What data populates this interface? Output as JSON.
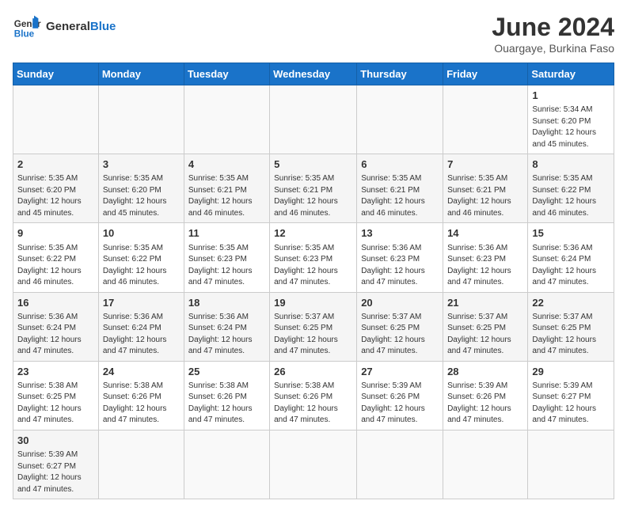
{
  "header": {
    "logo_line1": "General",
    "logo_line2": "Blue",
    "month_title": "June 2024",
    "subtitle": "Ouargaye, Burkina Faso"
  },
  "days_of_week": [
    "Sunday",
    "Monday",
    "Tuesday",
    "Wednesday",
    "Thursday",
    "Friday",
    "Saturday"
  ],
  "weeks": [
    [
      {
        "day": "",
        "info": ""
      },
      {
        "day": "",
        "info": ""
      },
      {
        "day": "",
        "info": ""
      },
      {
        "day": "",
        "info": ""
      },
      {
        "day": "",
        "info": ""
      },
      {
        "day": "",
        "info": ""
      },
      {
        "day": "1",
        "info": "Sunrise: 5:34 AM\nSunset: 6:20 PM\nDaylight: 12 hours and 45 minutes."
      }
    ],
    [
      {
        "day": "2",
        "info": "Sunrise: 5:35 AM\nSunset: 6:20 PM\nDaylight: 12 hours and 45 minutes."
      },
      {
        "day": "3",
        "info": "Sunrise: 5:35 AM\nSunset: 6:20 PM\nDaylight: 12 hours and 45 minutes."
      },
      {
        "day": "4",
        "info": "Sunrise: 5:35 AM\nSunset: 6:21 PM\nDaylight: 12 hours and 46 minutes."
      },
      {
        "day": "5",
        "info": "Sunrise: 5:35 AM\nSunset: 6:21 PM\nDaylight: 12 hours and 46 minutes."
      },
      {
        "day": "6",
        "info": "Sunrise: 5:35 AM\nSunset: 6:21 PM\nDaylight: 12 hours and 46 minutes."
      },
      {
        "day": "7",
        "info": "Sunrise: 5:35 AM\nSunset: 6:21 PM\nDaylight: 12 hours and 46 minutes."
      },
      {
        "day": "8",
        "info": "Sunrise: 5:35 AM\nSunset: 6:22 PM\nDaylight: 12 hours and 46 minutes."
      }
    ],
    [
      {
        "day": "9",
        "info": "Sunrise: 5:35 AM\nSunset: 6:22 PM\nDaylight: 12 hours and 46 minutes."
      },
      {
        "day": "10",
        "info": "Sunrise: 5:35 AM\nSunset: 6:22 PM\nDaylight: 12 hours and 46 minutes."
      },
      {
        "day": "11",
        "info": "Sunrise: 5:35 AM\nSunset: 6:23 PM\nDaylight: 12 hours and 47 minutes."
      },
      {
        "day": "12",
        "info": "Sunrise: 5:35 AM\nSunset: 6:23 PM\nDaylight: 12 hours and 47 minutes."
      },
      {
        "day": "13",
        "info": "Sunrise: 5:36 AM\nSunset: 6:23 PM\nDaylight: 12 hours and 47 minutes."
      },
      {
        "day": "14",
        "info": "Sunrise: 5:36 AM\nSunset: 6:23 PM\nDaylight: 12 hours and 47 minutes."
      },
      {
        "day": "15",
        "info": "Sunrise: 5:36 AM\nSunset: 6:24 PM\nDaylight: 12 hours and 47 minutes."
      }
    ],
    [
      {
        "day": "16",
        "info": "Sunrise: 5:36 AM\nSunset: 6:24 PM\nDaylight: 12 hours and 47 minutes."
      },
      {
        "day": "17",
        "info": "Sunrise: 5:36 AM\nSunset: 6:24 PM\nDaylight: 12 hours and 47 minutes."
      },
      {
        "day": "18",
        "info": "Sunrise: 5:36 AM\nSunset: 6:24 PM\nDaylight: 12 hours and 47 minutes."
      },
      {
        "day": "19",
        "info": "Sunrise: 5:37 AM\nSunset: 6:25 PM\nDaylight: 12 hours and 47 minutes."
      },
      {
        "day": "20",
        "info": "Sunrise: 5:37 AM\nSunset: 6:25 PM\nDaylight: 12 hours and 47 minutes."
      },
      {
        "day": "21",
        "info": "Sunrise: 5:37 AM\nSunset: 6:25 PM\nDaylight: 12 hours and 47 minutes."
      },
      {
        "day": "22",
        "info": "Sunrise: 5:37 AM\nSunset: 6:25 PM\nDaylight: 12 hours and 47 minutes."
      }
    ],
    [
      {
        "day": "23",
        "info": "Sunrise: 5:38 AM\nSunset: 6:25 PM\nDaylight: 12 hours and 47 minutes."
      },
      {
        "day": "24",
        "info": "Sunrise: 5:38 AM\nSunset: 6:26 PM\nDaylight: 12 hours and 47 minutes."
      },
      {
        "day": "25",
        "info": "Sunrise: 5:38 AM\nSunset: 6:26 PM\nDaylight: 12 hours and 47 minutes."
      },
      {
        "day": "26",
        "info": "Sunrise: 5:38 AM\nSunset: 6:26 PM\nDaylight: 12 hours and 47 minutes."
      },
      {
        "day": "27",
        "info": "Sunrise: 5:39 AM\nSunset: 6:26 PM\nDaylight: 12 hours and 47 minutes."
      },
      {
        "day": "28",
        "info": "Sunrise: 5:39 AM\nSunset: 6:26 PM\nDaylight: 12 hours and 47 minutes."
      },
      {
        "day": "29",
        "info": "Sunrise: 5:39 AM\nSunset: 6:27 PM\nDaylight: 12 hours and 47 minutes."
      }
    ],
    [
      {
        "day": "30",
        "info": "Sunrise: 5:39 AM\nSunset: 6:27 PM\nDaylight: 12 hours and 47 minutes."
      },
      {
        "day": "",
        "info": ""
      },
      {
        "day": "",
        "info": ""
      },
      {
        "day": "",
        "info": ""
      },
      {
        "day": "",
        "info": ""
      },
      {
        "day": "",
        "info": ""
      },
      {
        "day": "",
        "info": ""
      }
    ]
  ]
}
